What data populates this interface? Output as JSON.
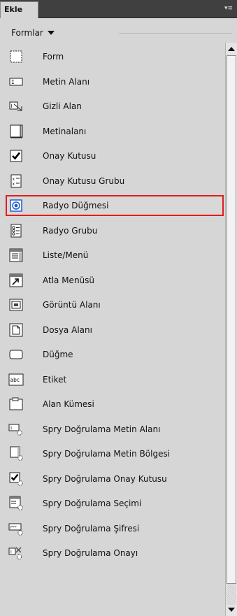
{
  "panel": {
    "tab_label": "Ekle",
    "category_label": "Formlar"
  },
  "items": [
    {
      "label": "Form",
      "icon": "form-icon"
    },
    {
      "label": "Metin Alanı",
      "icon": "text-field-icon"
    },
    {
      "label": "Gizli Alan",
      "icon": "hidden-field-icon"
    },
    {
      "label": "Metinalanı",
      "icon": "textarea-icon"
    },
    {
      "label": "Onay Kutusu",
      "icon": "checkbox-icon"
    },
    {
      "label": "Onay Kutusu Grubu",
      "icon": "checkbox-group-icon"
    },
    {
      "label": "Radyo Düğmesi",
      "icon": "radio-button-icon",
      "selected": true
    },
    {
      "label": "Radyo Grubu",
      "icon": "radio-group-icon"
    },
    {
      "label": "Liste/Menü",
      "icon": "list-menu-icon"
    },
    {
      "label": "Atla Menüsü",
      "icon": "jump-menu-icon"
    },
    {
      "label": "Görüntü Alanı",
      "icon": "image-field-icon"
    },
    {
      "label": "Dosya Alanı",
      "icon": "file-field-icon"
    },
    {
      "label": "Düğme",
      "icon": "button-icon"
    },
    {
      "label": "Etiket",
      "icon": "label-icon"
    },
    {
      "label": "Alan Kümesi",
      "icon": "fieldset-icon"
    },
    {
      "label": "Spry Doğrulama Metin Alanı",
      "icon": "spry-text-field-icon"
    },
    {
      "label": "Spry Doğrulama Metin Bölgesi",
      "icon": "spry-textarea-icon"
    },
    {
      "label": "Spry Doğrulama Onay Kutusu",
      "icon": "spry-checkbox-icon"
    },
    {
      "label": "Spry Doğrulama Seçimi",
      "icon": "spry-select-icon"
    },
    {
      "label": "Spry Doğrulama Şifresi",
      "icon": "spry-password-icon"
    },
    {
      "label": "Spry Doğrulama Onayı",
      "icon": "spry-confirm-icon"
    }
  ],
  "colors": {
    "selection_border": "#e41b1b",
    "panel_background": "#d6d6d6",
    "radio_blue": "#1f5fd0"
  }
}
